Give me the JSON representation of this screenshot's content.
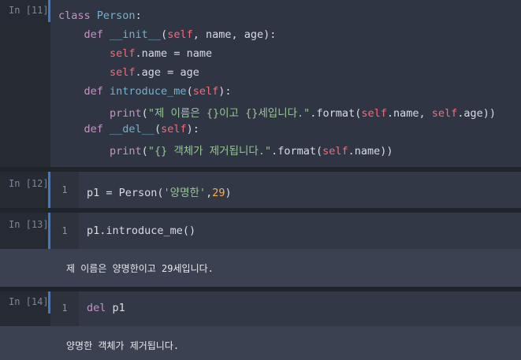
{
  "cells": [
    {
      "prompt": "In [11]:",
      "lines": [
        [
          {
            "t": "class ",
            "c": "kw"
          },
          {
            "t": "Person",
            "c": "cls"
          },
          {
            "t": ":",
            "c": ""
          }
        ],
        [
          {
            "t": "    def ",
            "c": "kw"
          },
          {
            "t": "__init__",
            "c": "fn"
          },
          {
            "t": "(",
            "c": ""
          },
          {
            "t": "self",
            "c": "self"
          },
          {
            "t": ", name, age):",
            "c": ""
          }
        ],
        [
          {
            "t": "        ",
            "c": ""
          },
          {
            "t": "self",
            "c": "self"
          },
          {
            "t": ".name = name",
            "c": ""
          }
        ],
        [
          {
            "t": "        ",
            "c": ""
          },
          {
            "t": "self",
            "c": "self"
          },
          {
            "t": ".age = age",
            "c": ""
          }
        ],
        [
          {
            "t": "    def ",
            "c": "kw"
          },
          {
            "t": "introduce_me",
            "c": "fn"
          },
          {
            "t": "(",
            "c": ""
          },
          {
            "t": "self",
            "c": "self"
          },
          {
            "t": "):",
            "c": ""
          }
        ],
        [
          {
            "t": "        ",
            "c": ""
          },
          {
            "t": "print",
            "c": "kw"
          },
          {
            "t": "(",
            "c": ""
          },
          {
            "t": "\"제 이름은 {}이고 {}세입니다.\"",
            "c": "str"
          },
          {
            "t": ".format(",
            "c": ""
          },
          {
            "t": "self",
            "c": "self"
          },
          {
            "t": ".name, ",
            "c": ""
          },
          {
            "t": "self",
            "c": "self"
          },
          {
            "t": ".age))",
            "c": ""
          }
        ],
        [
          {
            "t": "    def ",
            "c": "kw"
          },
          {
            "t": "__del__",
            "c": "fn"
          },
          {
            "t": "(",
            "c": ""
          },
          {
            "t": "self",
            "c": "self"
          },
          {
            "t": "):",
            "c": ""
          }
        ],
        [
          {
            "t": "        ",
            "c": ""
          },
          {
            "t": "print",
            "c": "kw"
          },
          {
            "t": "(",
            "c": ""
          },
          {
            "t": "\"{} 객체가 제거됩니다.\"",
            "c": "str"
          },
          {
            "t": ".format(",
            "c": ""
          },
          {
            "t": "self",
            "c": "self"
          },
          {
            "t": ".name))",
            "c": ""
          }
        ]
      ]
    },
    {
      "prompt": "In [12]:",
      "line_number": "1",
      "lines": [
        [
          {
            "t": "p1 = Person(",
            "c": ""
          },
          {
            "t": "'양명한'",
            "c": "str"
          },
          {
            "t": ",",
            "c": ""
          },
          {
            "t": "29",
            "c": "num"
          },
          {
            "t": ")",
            "c": ""
          }
        ]
      ]
    },
    {
      "prompt": "In [13]:",
      "line_number": "1",
      "lines": [
        [
          {
            "t": "p1.introduce_me()",
            "c": ""
          }
        ]
      ],
      "output": "제 이름은 양명한이고 29세입니다."
    },
    {
      "prompt": "In [14]:",
      "line_number": "1",
      "lines": [
        [
          {
            "t": "del ",
            "c": "kw"
          },
          {
            "t": "p1",
            "c": ""
          }
        ]
      ],
      "output": "양명한 객체가 제거됩니다."
    }
  ]
}
